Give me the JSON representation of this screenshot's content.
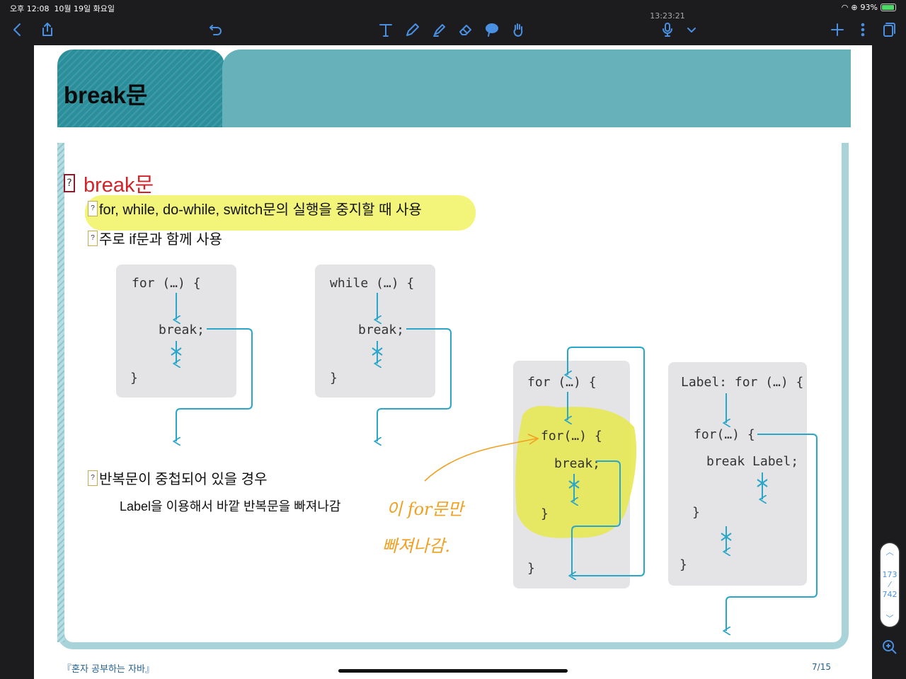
{
  "status": {
    "time": "오후 12:08",
    "date": "10월 19일 화요일",
    "battery": "93%"
  },
  "toolbar": {
    "clock": "13:23:21"
  },
  "slide": {
    "title": "break문",
    "heading": "break문",
    "bullet1": "for, while, do-while, switch문의 실행을 중지할 때 사용",
    "bullet2": "주로 if문과 함께 사용",
    "bullet3": "반복문이 중첩되어 있을 경우",
    "sub": "Label을 이용해서 바깥 반복문을 빠져나감",
    "footer": "『혼자 공부하는 자바』",
    "page": "7/15"
  },
  "code": {
    "box1": [
      "for (…) {",
      "break;",
      "}"
    ],
    "box2": [
      "while (…) {",
      "break;",
      "}"
    ],
    "box3": [
      "for (…) {",
      "for(…) {",
      "break;",
      "}",
      "}"
    ],
    "box4": [
      "Label: for (…) {",
      "for(…) {",
      "break Label;",
      "}",
      "}"
    ]
  },
  "annotation": {
    "line1": "이 for문만",
    "line2": "빠져나감."
  },
  "pager": {
    "current": "173",
    "total": "742"
  },
  "colors": {
    "teal_dark": "#2b8f9b",
    "teal_light": "#66b1ba",
    "arrow": "#2aa6c9",
    "highlight": "#f2f36c",
    "annotation": "#f0a020"
  }
}
